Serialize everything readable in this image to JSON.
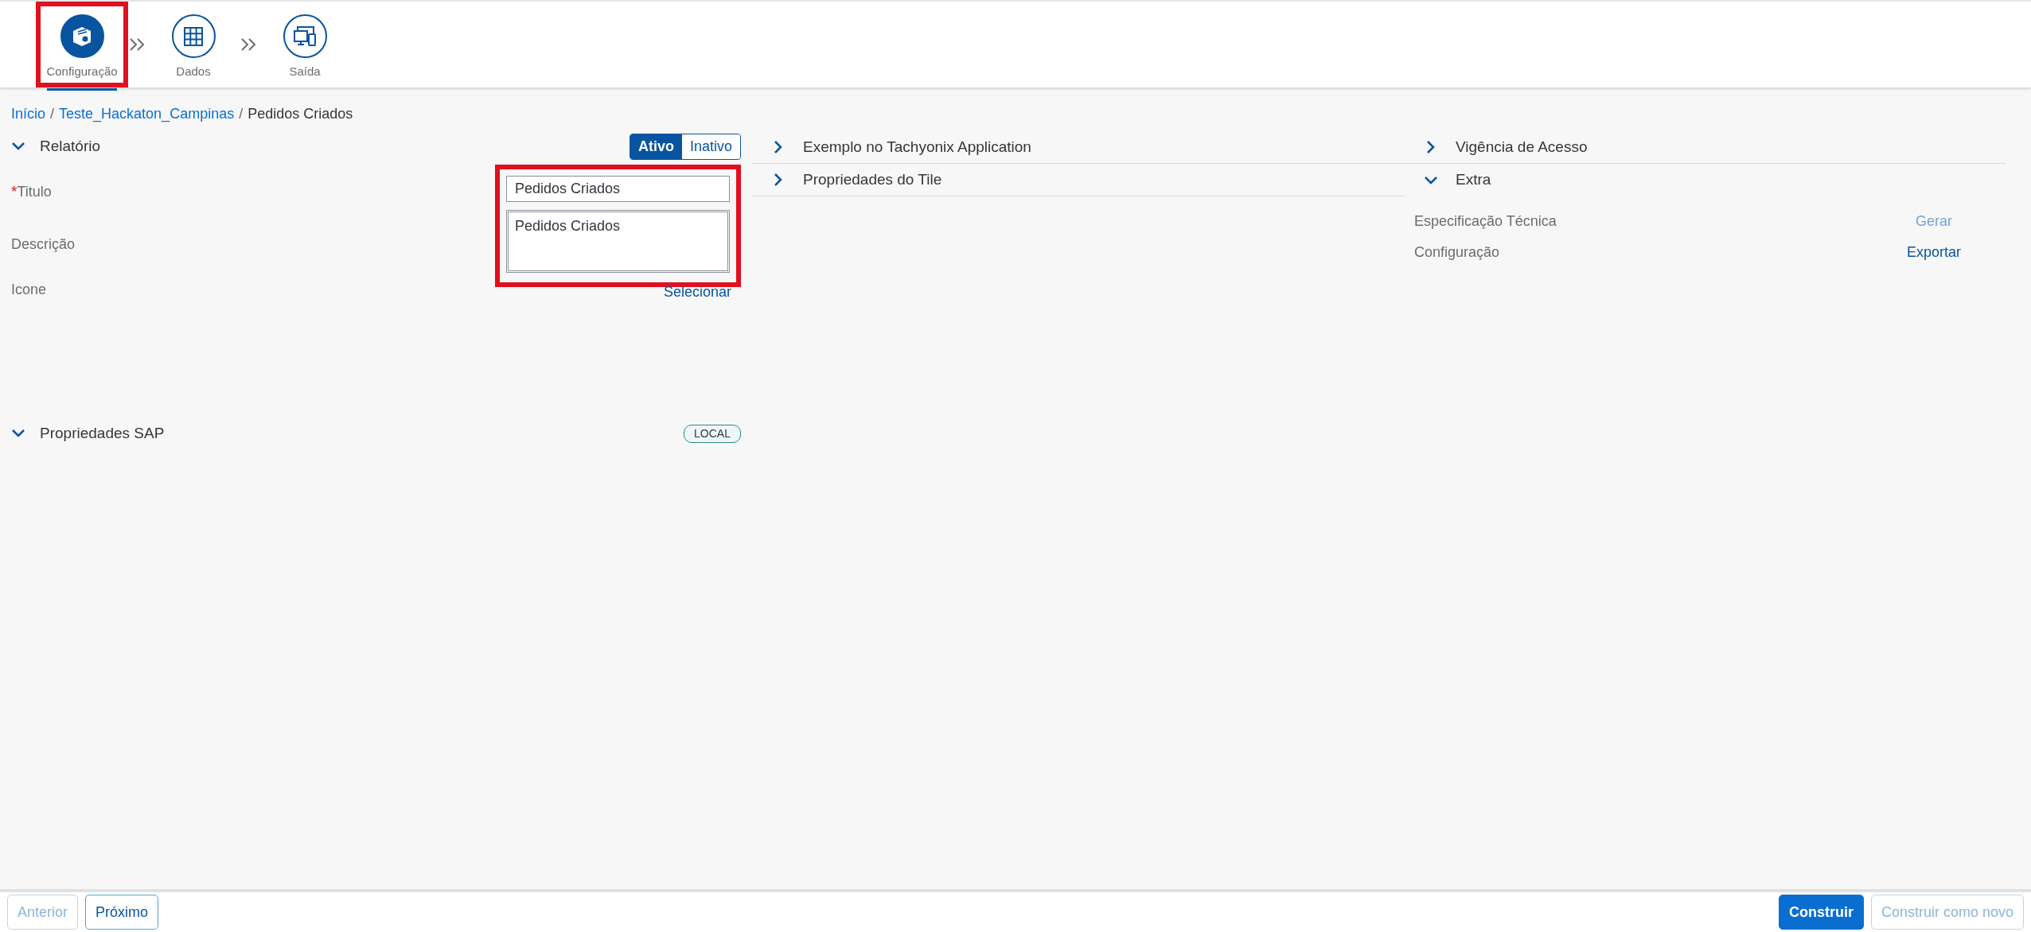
{
  "steps": [
    {
      "label": "Configuração",
      "kind": "cube",
      "selected": true,
      "highlighted": true
    },
    {
      "label": "Dados",
      "kind": "grid",
      "selected": false,
      "highlighted": false
    },
    {
      "label": "Saída",
      "kind": "devices",
      "selected": false,
      "highlighted": false
    }
  ],
  "breadcrumb": [
    {
      "label": "Início",
      "kind": "link"
    },
    {
      "label": "/",
      "kind": "separator"
    },
    {
      "label": "Teste_Hackaton_Campinas",
      "kind": "link"
    },
    {
      "label": "/",
      "kind": "separator"
    },
    {
      "label": "Pedidos Criados",
      "kind": "current"
    }
  ],
  "report_section": {
    "title": "Relatório",
    "expanded": true,
    "status_toggle": [
      {
        "label": "Ativo",
        "selected": true
      },
      {
        "label": "Inativo",
        "selected": false
      }
    ],
    "fields_highlighted": true,
    "fields": [
      {
        "label": "Titulo",
        "required_mark": "*",
        "kind": "input",
        "value": "Pedidos Criados"
      },
      {
        "label": "Descrição",
        "kind": "textarea",
        "value": "Pedidos Criados"
      },
      {
        "label": "Icone",
        "kind": "link",
        "value": "Selecionar"
      }
    ]
  },
  "sap_section": {
    "title": "Propriedades SAP",
    "expanded": true,
    "badge": "LOCAL"
  },
  "middle_sections": [
    {
      "title": "Exemplo no Tachyonix Application",
      "expanded": false
    },
    {
      "title": "Propriedades do Tile",
      "expanded": false
    }
  ],
  "right_sections": [
    {
      "title": "Vigência de Acesso",
      "expanded": false
    },
    {
      "title": "Extra",
      "expanded": true,
      "items": [
        {
          "label": "Especificação Técnica",
          "action": "Gerar",
          "disabled": true
        },
        {
          "label": "Configuração",
          "action": "Exportar",
          "disabled": false
        }
      ]
    }
  ],
  "footer": {
    "left_buttons": [
      {
        "label": "Anterior",
        "kind": "secondary",
        "disabled": true
      },
      {
        "label": "Próximo",
        "kind": "secondary",
        "disabled": false
      }
    ],
    "right_buttons": [
      {
        "label": "Construir",
        "kind": "primary",
        "disabled": false
      },
      {
        "label": "Construir como novo",
        "kind": "secondary",
        "disabled": true
      }
    ]
  }
}
